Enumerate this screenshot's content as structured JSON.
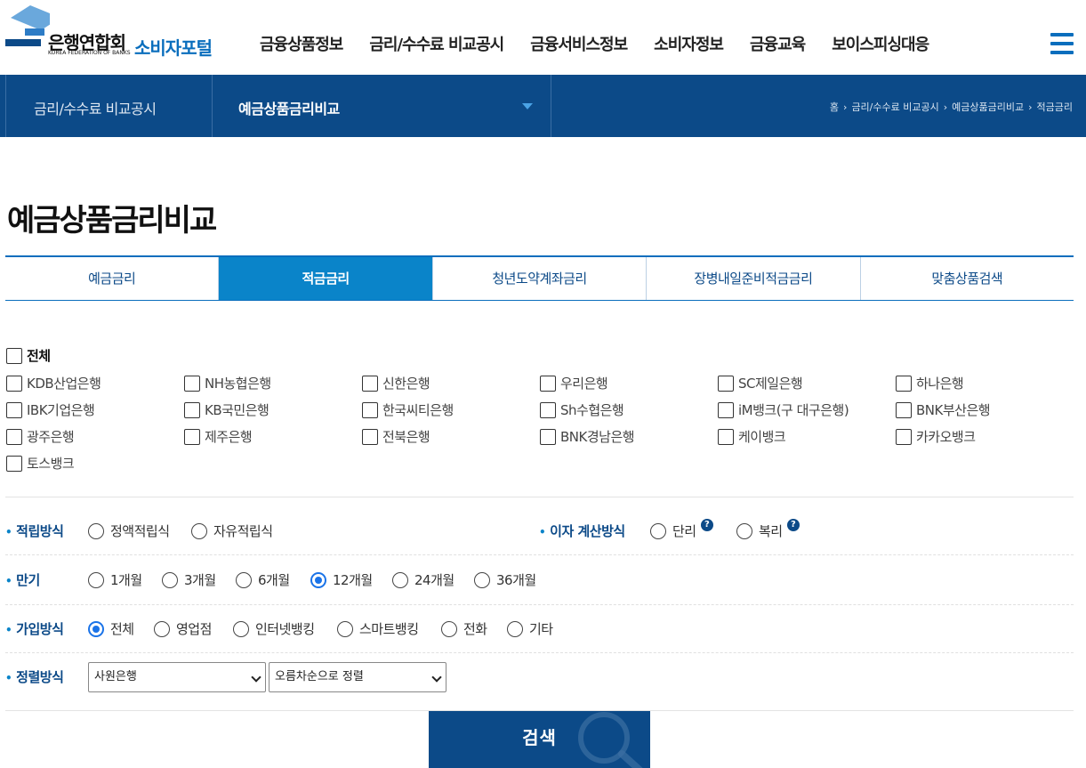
{
  "header": {
    "logo_text": "은행연합회",
    "logo_sub": "KOREA FEDERATION OF BANKS",
    "portal": "소비자포털",
    "nav": [
      "금융상품정보",
      "금리/수수료 비교공시",
      "금융서비스정보",
      "소비자정보",
      "금융교육",
      "보이스피싱대응"
    ]
  },
  "subbar": {
    "section": "금리/수수료 비교공시",
    "current": "예금상품금리비교",
    "breadcrumb": [
      "홈",
      "금리/수수료 비교공시",
      "예금상품금리비교",
      "적금금리"
    ]
  },
  "page_title": "예금상품금리비교",
  "tabs": [
    "예금금리",
    "적금금리",
    "청년도약계좌금리",
    "장병내일준비적금금리",
    "맞춤상품검색"
  ],
  "active_tab": "적금금리",
  "banks": {
    "all_label": "전체",
    "list": [
      "KDB산업은행",
      "NH농협은행",
      "신한은행",
      "우리은행",
      "SC제일은행",
      "하나은행",
      "IBK기업은행",
      "KB국민은행",
      "한국씨티은행",
      "Sh수협은행",
      "iM뱅크(구 대구은행)",
      "BNK부산은행",
      "광주은행",
      "제주은행",
      "전북은행",
      "BNK경남은행",
      "케이뱅크",
      "카카오뱅크",
      "토스뱅크"
    ]
  },
  "options": {
    "saving_method": {
      "label": "적립방식",
      "choices": [
        "정액적립식",
        "자유적립식"
      ]
    },
    "interest_method": {
      "label": "이자 계산방식",
      "choices": [
        "단리",
        "복리"
      ],
      "help": "?"
    },
    "term": {
      "label": "만기",
      "choices": [
        "1개월",
        "3개월",
        "6개월",
        "12개월",
        "24개월",
        "36개월"
      ],
      "selected": "12개월"
    },
    "join_method": {
      "label": "가입방식",
      "choices": [
        "전체",
        "영업점",
        "인터넷뱅킹",
        "스마트뱅킹",
        "전화",
        "기타"
      ],
      "selected": "전체"
    },
    "sort": {
      "label": "정렬방식",
      "by": "사원은행",
      "order": "오름차순으로 정렬"
    }
  },
  "search_button": "검색",
  "colors": {
    "primary": "#0c4a88",
    "accent": "#0a84c9",
    "radio_selected": "#1a73e8"
  }
}
